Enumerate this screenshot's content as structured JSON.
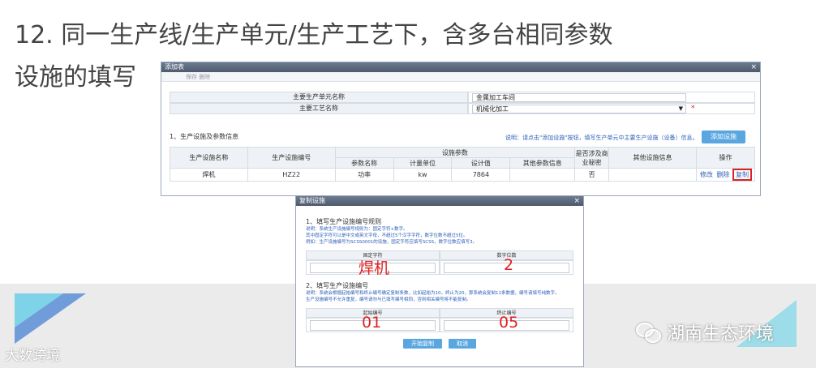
{
  "slide": {
    "title_line1": "12. 同一生产线/生产单元/生产工艺下，含多台相同参数",
    "title_line2": "设施的填写"
  },
  "watermark": {
    "left_text": "大数跨境",
    "right_text": "湖南生态环境"
  },
  "window_add": {
    "title": "添加表",
    "close_glyph": "×",
    "ghost_text": "保存  删除",
    "form": {
      "unit_label": "主要生产单元名称",
      "unit_value": "金属加工车间",
      "process_label": "主要工艺名称",
      "process_value": "机械化加工",
      "required_mark": "*"
    },
    "section_title": "1、生产设施及参数信息",
    "hint": "说明：请点击\"添加设施\"按钮，填写生产单元中主要生产设施（设备）信息。",
    "add_button": "添加设施",
    "table": {
      "h_facility_name": "生产设施名称",
      "h_facility_code": "生产设施编号",
      "h_params": "设施参数",
      "h_param_name": "参数名称",
      "h_unit": "计量单位",
      "h_design": "设计值",
      "h_other_params": "其他参数信息",
      "h_secret": "是否涉及商业秘密",
      "h_other_info": "其他设施信息",
      "h_ops": "操作",
      "row": {
        "facility_name": "焊机",
        "facility_code": "HZ22",
        "param_name": "功率",
        "unit": "kw",
        "design": "7864",
        "other_params": "",
        "secret": "否",
        "other_info": "",
        "op_edit": "修改",
        "op_delete": "删除",
        "op_copy": "复制"
      }
    }
  },
  "window_copy": {
    "title": "复制设施",
    "close_glyph": "×",
    "s1_title": "1、填写生产设施编号规则",
    "s1_note1": "说明：系统生产设施编号规则为：固定字符+数字。",
    "s1_note2": "其中固定字符可以是中文或英文字母，不超过5个汉字字符，数字位数不超过5位。",
    "s1_note3": "例如：生产设施编号为SCSS0001的设施，固定字符应填写SCSS，数字位数应填写3。",
    "fixed_chars_label": "固定字符",
    "digits_label": "数字位数",
    "fixed_chars_annotation": "焊机",
    "digits_annotation": "2",
    "s2_title": "2、填写生产设施编号",
    "s2_note1": "说明：系统会根据起始编号和终止编号确定复制条数，比如起始为10，终止为20，那系统会复制11条数据，编号请填写纯数字。",
    "s2_note2": "生产设施编号不允许重复，编号请勿与已填写编号相同，否则相关编号将不能复制。",
    "start_label": "起始编号",
    "end_label": "终止编号",
    "start_annotation": "01",
    "end_annotation": "05",
    "btn_start": "开始复制",
    "btn_cancel": "取消"
  }
}
